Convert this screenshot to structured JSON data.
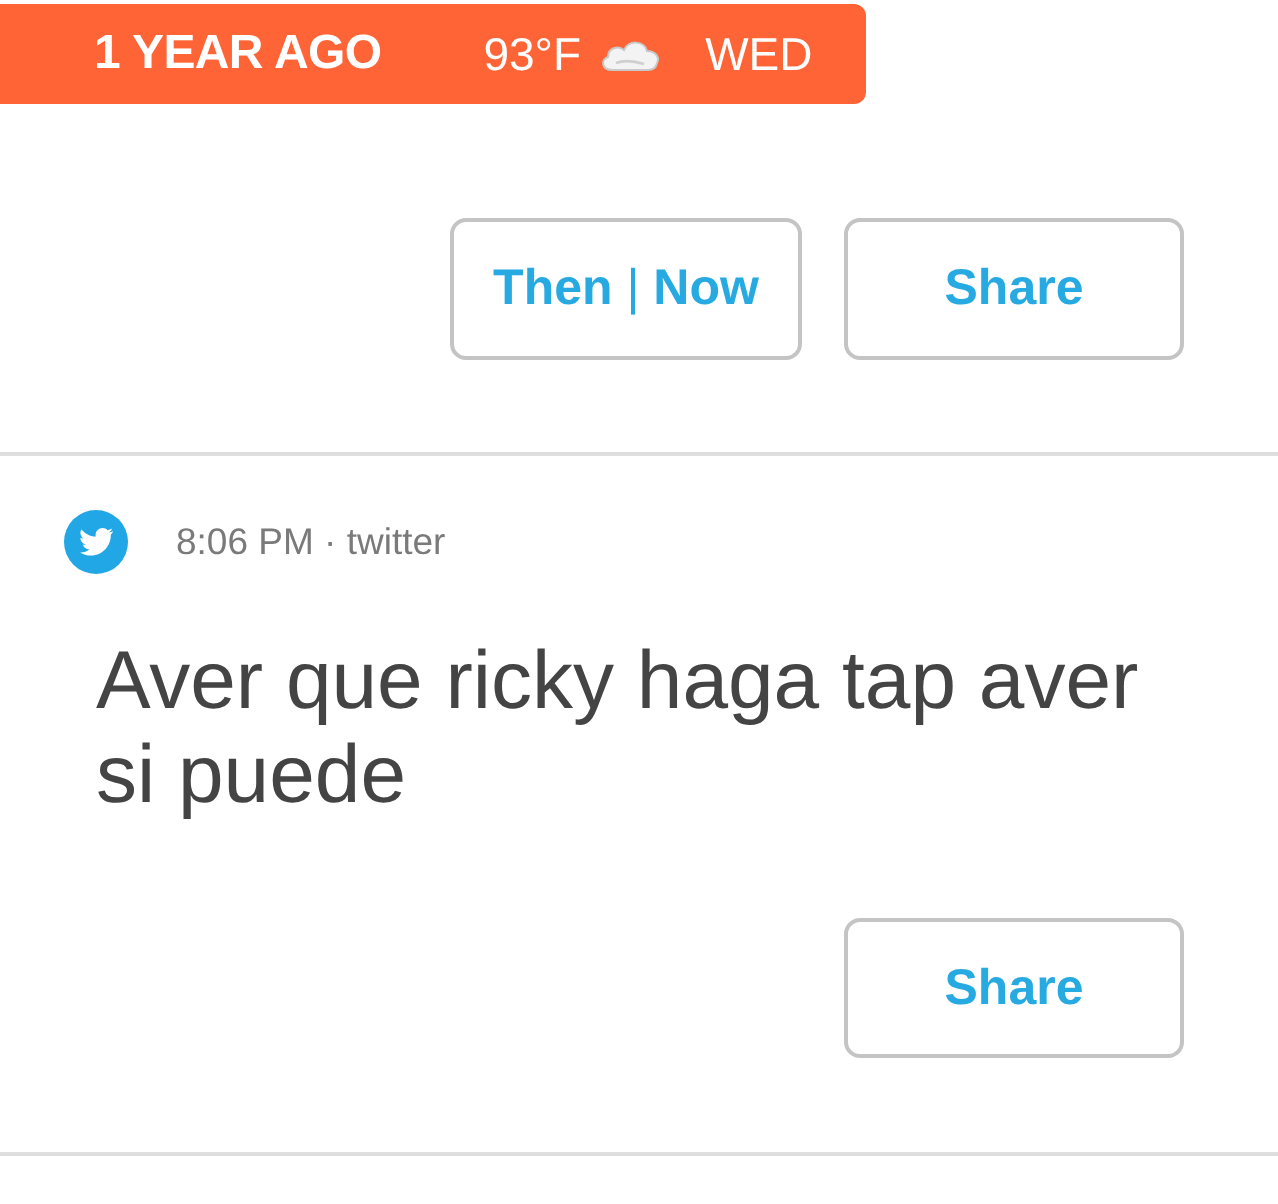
{
  "banner": {
    "age": "1 YEAR AGO",
    "temperature": "93°F",
    "day": "WED"
  },
  "top_actions": [
    {
      "label": "**Then** | **Now**"
    },
    {
      "label": "Share"
    }
  ],
  "posts": [
    {
      "kind": "twitter",
      "meta": "8:06 PM · twitter",
      "text": "Aver que ricky haga tap aver si puede",
      "actions": [
        {
          "label": "Share"
        }
      ]
    }
  ]
}
